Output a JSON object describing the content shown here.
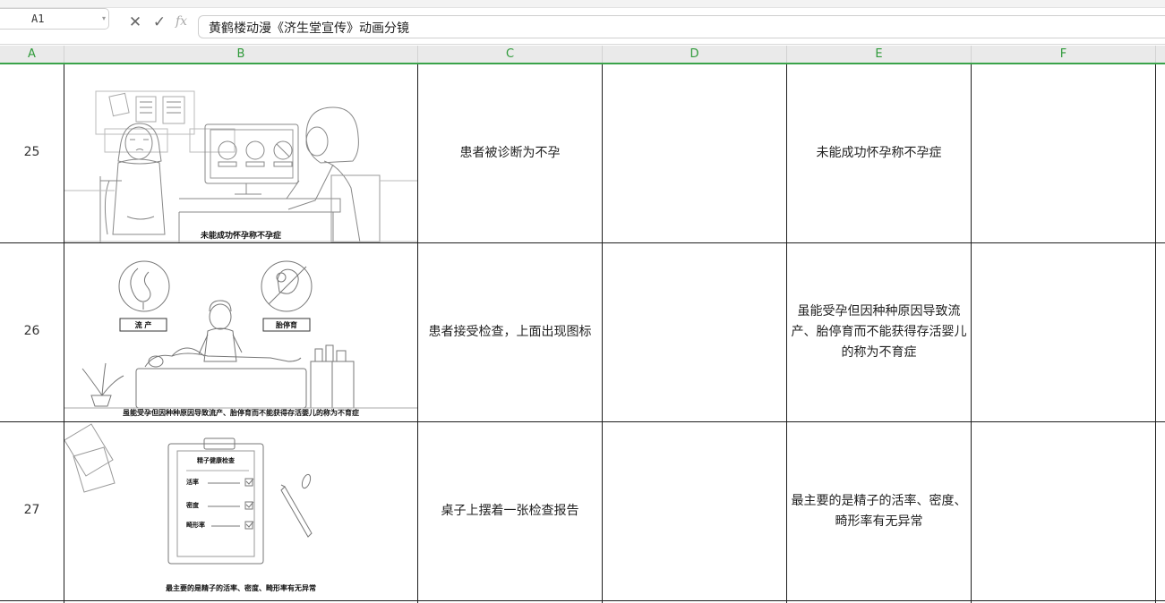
{
  "formula_bar": {
    "name_box": "A1",
    "cancel_icon": "close-icon",
    "confirm_icon": "check-icon",
    "fx_label": "fx",
    "content": "黄鹤楼动漫《济生堂宣传》动画分镜"
  },
  "columns": [
    "A",
    "B",
    "C",
    "D",
    "E",
    "F"
  ],
  "rows": [
    {
      "number": "25",
      "caption": "未能成功怀孕称不孕症",
      "c": "患者被诊断为不孕",
      "d": "",
      "e": "未能成功怀孕称不孕症",
      "f": ""
    },
    {
      "number": "26",
      "caption": "虽能受孕但因种种原因导致流产、胎停育而不能获得存活婴儿的称为不育症",
      "labels": [
        "流 产",
        "胎停育"
      ],
      "c": "患者接受检查，上面出现图标",
      "d": "",
      "e": "虽能受孕但因种种原因导致流产、胎停育而不能获得存活婴儿的称为不育症",
      "f": ""
    },
    {
      "number": "27",
      "caption": "最主要的是精子的活率、密度、畸形率有无异常",
      "report": {
        "title": "精子健康检查",
        "items": [
          "活率",
          "密度",
          "畸形率"
        ]
      },
      "c": "桌子上摆着一张检查报告",
      "d": "",
      "e": "最主要的是精子的活率、密度、畸形率有无异常",
      "f": ""
    }
  ],
  "colors": {
    "header_text": "#2f9a3a",
    "header_line": "#3aa34a",
    "grid": "#1e1e1e"
  }
}
